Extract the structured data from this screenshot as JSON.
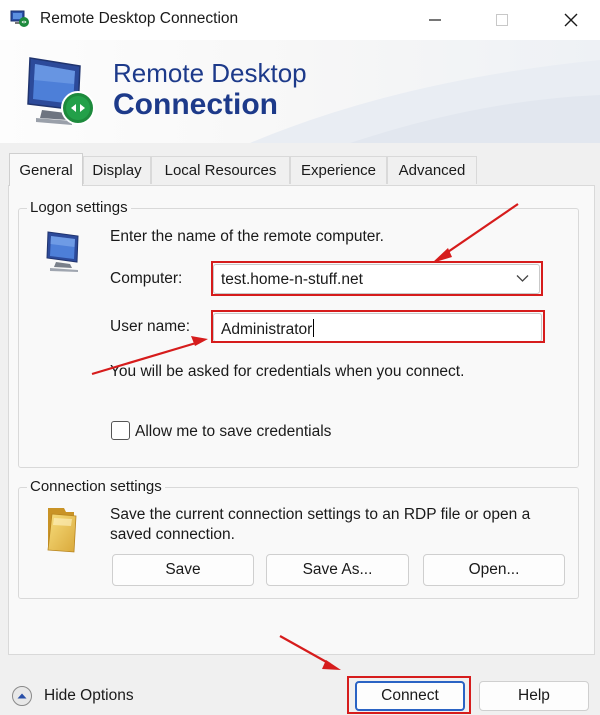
{
  "window": {
    "title": "Remote Desktop Connection"
  },
  "banner": {
    "line1": "Remote Desktop",
    "line2": "Connection"
  },
  "tabs": [
    {
      "label": "General",
      "active": true
    },
    {
      "label": "Display"
    },
    {
      "label": "Local Resources"
    },
    {
      "label": "Experience"
    },
    {
      "label": "Advanced"
    }
  ],
  "logon": {
    "group_label": "Logon settings",
    "instruction": "Enter the name of the remote computer.",
    "computer_label": "Computer:",
    "computer_value": "test.home-n-stuff.net",
    "username_label": "User name:",
    "username_value": "Administrator",
    "credentials_note": "You will be asked for credentials when you connect.",
    "save_credentials_label": "Allow me to save credentials",
    "save_credentials_checked": false
  },
  "connection": {
    "group_label": "Connection settings",
    "description": "Save the current connection settings to an RDP file or open a saved connection.",
    "save_label": "Save",
    "save_as_label": "Save As...",
    "open_label": "Open..."
  },
  "footer": {
    "hide_options_label": "Hide Options",
    "connect_label": "Connect",
    "help_label": "Help"
  },
  "colors": {
    "accent": "#1d3a8a",
    "annotation": "#d61c1c"
  },
  "icons": [
    "rdp-app-icon",
    "minimize-icon",
    "maximize-icon",
    "close-icon",
    "rdp-monitor-icon",
    "computer-icon",
    "folder-icon",
    "chevron-down-icon",
    "chevron-up-icon"
  ]
}
